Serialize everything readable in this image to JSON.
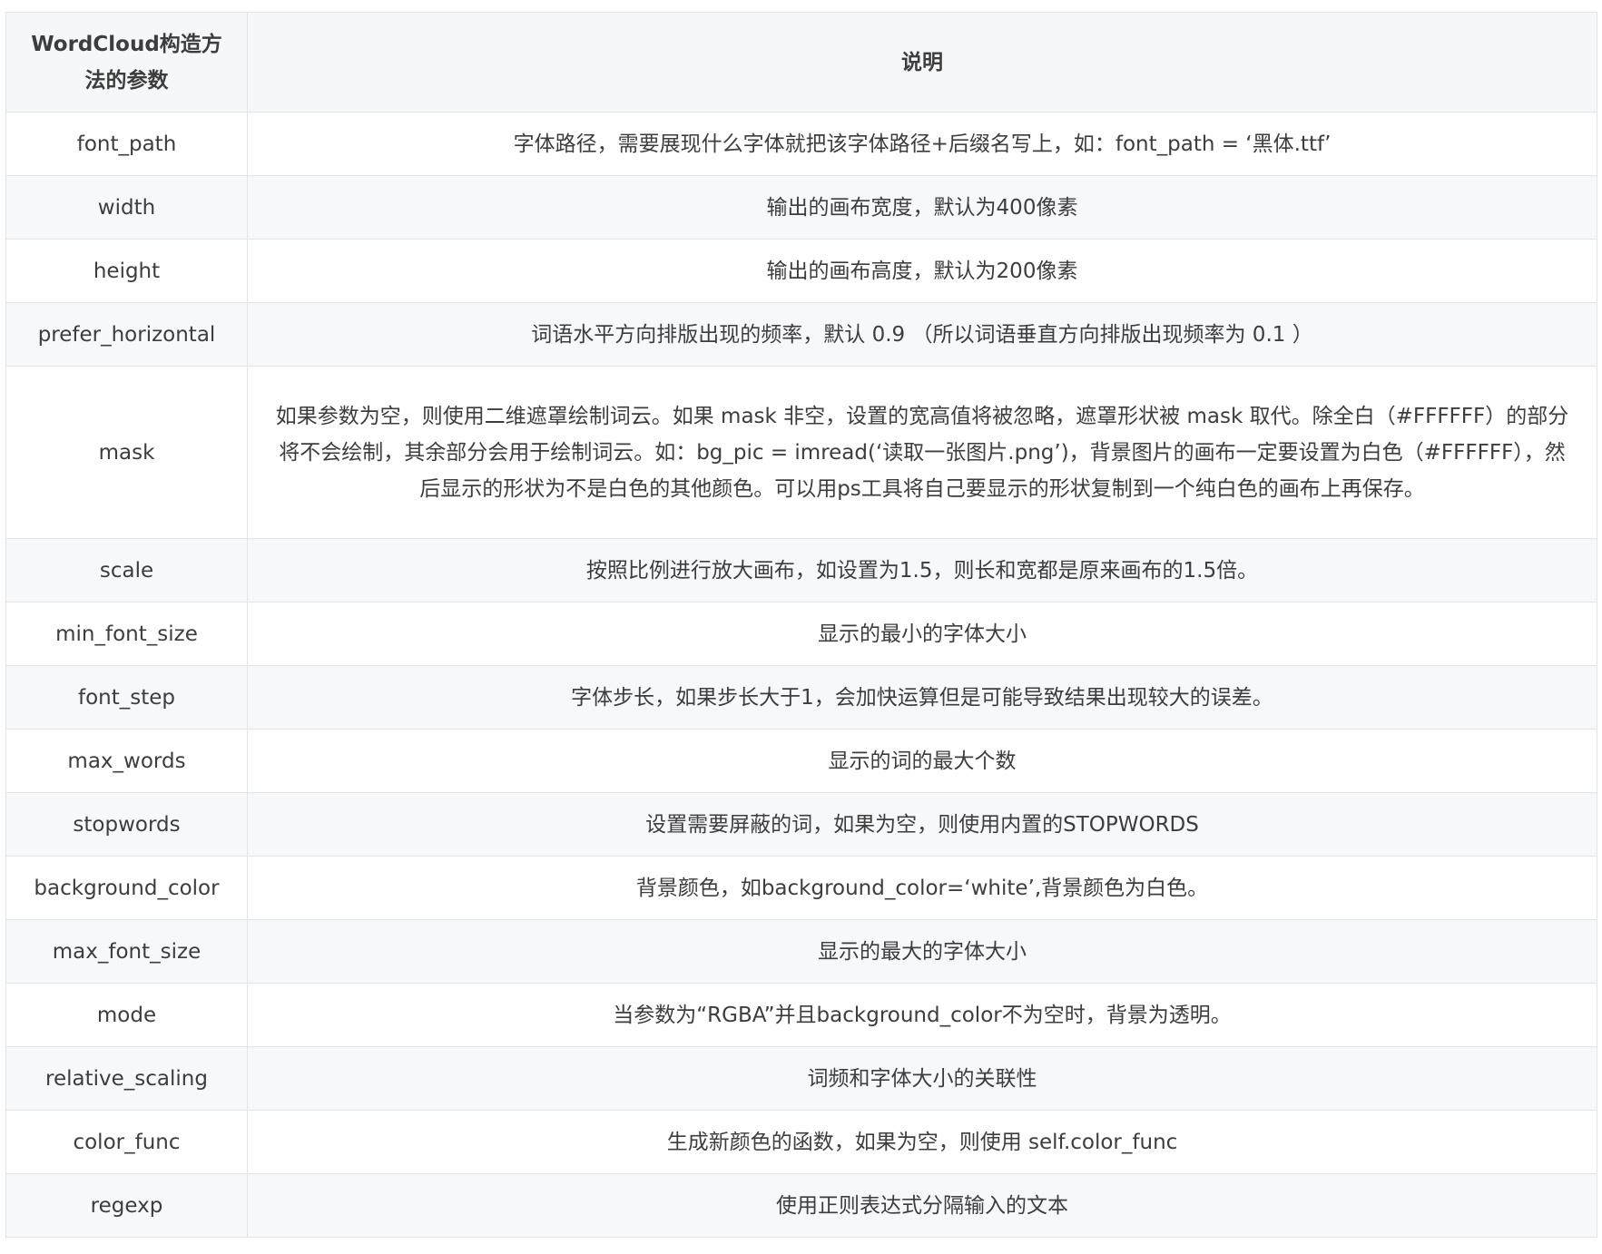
{
  "table": {
    "headers": [
      "WordCloud构造方法的参数",
      "说明"
    ],
    "rows": [
      {
        "param": "font_path",
        "desc": "字体路径，需要展现什么字体就把该字体路径+后缀名写上，如：font_path = ‘黑体.ttf’"
      },
      {
        "param": "width",
        "desc": "输出的画布宽度，默认为400像素"
      },
      {
        "param": "height",
        "desc": "输出的画布高度，默认为200像素"
      },
      {
        "param": "prefer_horizontal",
        "desc": "词语水平方向排版出现的频率，默认 0.9 （所以词语垂直方向排版出现频率为 0.1 ）"
      },
      {
        "param": "mask",
        "desc": "如果参数为空，则使用二维遮罩绘制词云。如果 mask 非空，设置的宽高值将被忽略，遮罩形状被 mask 取代。除全白（#FFFFFF）的部分将不会绘制，其余部分会用于绘制词云。如：bg_pic = imread(‘读取一张图片.png’)，背景图片的画布一定要设置为白色（#FFFFFF），然后显示的形状为不是白色的其他颜色。可以用ps工具将自己要显示的形状复制到一个纯白色的画布上再保存。"
      },
      {
        "param": "scale",
        "desc": "按照比例进行放大画布，如设置为1.5，则长和宽都是原来画布的1.5倍。"
      },
      {
        "param": "min_font_size",
        "desc": "显示的最小的字体大小"
      },
      {
        "param": "font_step",
        "desc": "字体步长，如果步长大于1，会加快运算但是可能导致结果出现较大的误差。"
      },
      {
        "param": "max_words",
        "desc": "显示的词的最大个数"
      },
      {
        "param": "stopwords",
        "desc": "设置需要屏蔽的词，如果为空，则使用内置的STOPWORDS"
      },
      {
        "param": "background_color",
        "desc": "背景颜色，如background_color=‘white’,背景颜色为白色。"
      },
      {
        "param": "max_font_size",
        "desc": "显示的最大的字体大小"
      },
      {
        "param": "mode",
        "desc": "当参数为“RGBA”并且background_color不为空时，背景为透明。"
      },
      {
        "param": "relative_scaling",
        "desc": "词频和字体大小的关联性"
      },
      {
        "param": "color_func",
        "desc": "生成新颜色的函数，如果为空，则使用 self.color_func"
      },
      {
        "param": "regexp",
        "desc": "使用正则表达式分隔输入的文本"
      }
    ]
  }
}
